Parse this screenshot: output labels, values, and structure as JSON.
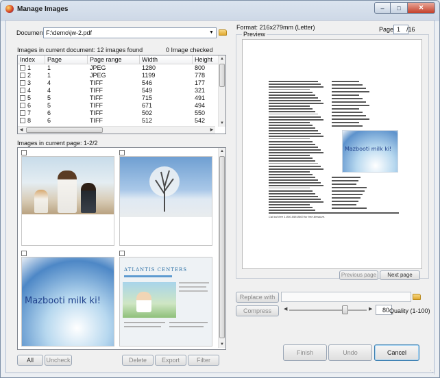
{
  "window": {
    "title": "Manage Images"
  },
  "document": {
    "label": "Document",
    "path": "F:\\demo\\jw-2.pdf"
  },
  "images_table": {
    "summary_left": "Images in current document: 12 images found",
    "summary_right": "0 Image checked",
    "columns": [
      "Index",
      "Page",
      "Page range",
      "Width",
      "Height"
    ],
    "rows": [
      [
        "1",
        "1",
        "JPEG",
        "1280",
        "800"
      ],
      [
        "2",
        "1",
        "JPEG",
        "1199",
        "778"
      ],
      [
        "3",
        "4",
        "TIFF",
        "546",
        "177"
      ],
      [
        "4",
        "4",
        "TIFF",
        "549",
        "321"
      ],
      [
        "5",
        "5",
        "TIFF",
        "715",
        "491"
      ],
      [
        "6",
        "5",
        "TIFF",
        "671",
        "494"
      ],
      [
        "7",
        "6",
        "TIFF",
        "502",
        "550"
      ],
      [
        "8",
        "6",
        "TIFF",
        "512",
        "542"
      ]
    ]
  },
  "current_page": {
    "label": "Images in current page: 1-2/2",
    "thumb3_text": "Mazbooti milk ki!",
    "thumb4_text": "ATLANTIS CENTERS"
  },
  "left_buttons": {
    "all": "All",
    "uncheck": "Uncheck",
    "delete": "Delete",
    "export": "Export",
    "filter": "Filter"
  },
  "format": {
    "label": "Format: 216x279mm (Letter)",
    "page_label": "Page",
    "page_value": "1",
    "page_total": "/16",
    "preview_label": "Preview"
  },
  "preview_doc": {
    "ad_text": "Mazbooti milk ki!",
    "footer": "Call toll free 1-800-998-8800 for free literature."
  },
  "nav": {
    "previous": "Previous page",
    "next": "Next page"
  },
  "tools": {
    "replace": "Replace with",
    "compress": "Compress",
    "quality_value": "80",
    "quality_label": "Quality (1-100)",
    "quality": 80
  },
  "bottom_buttons": {
    "finish": "Finish",
    "undo": "Undo",
    "cancel": "Cancel"
  }
}
